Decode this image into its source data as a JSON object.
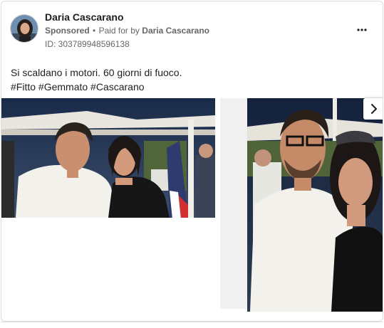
{
  "ad": {
    "page_name": "Daria Cascarano",
    "sponsored_label": "Sponsored",
    "separator": "•",
    "paid_for_prefix": "Paid for by",
    "payer_name": "Daria Cascarano",
    "ad_id": "ID: 303789948596138",
    "text_line_1": "Si scaldano i motori. 60 giorni di fuoco.",
    "text_line_2": "#Fitto #Gemmato #Cascarano",
    "more_icon": "more-horizontal-icon",
    "next_icon": "chevron-right-icon"
  },
  "carousel": {
    "slide_count_visible": 2
  },
  "colors": {
    "text_primary": "#1c1e21",
    "text_secondary": "#65676b",
    "border": "#dadde1"
  }
}
